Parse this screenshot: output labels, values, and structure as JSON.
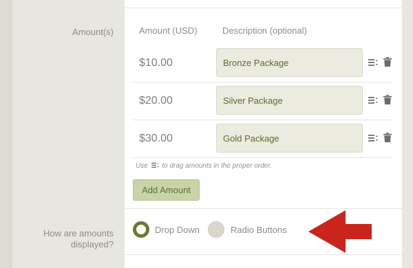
{
  "amounts_section": {
    "label": "Amount(s)",
    "col_amount": "Amount (USD)",
    "col_description": "Description (optional)",
    "rows": [
      {
        "amount": "$10.00",
        "description": "Bronze Package"
      },
      {
        "amount": "$20.00",
        "description": "Silver Package"
      },
      {
        "amount": "$30.00",
        "description": "Gold Package"
      }
    ],
    "hint_before": "Use",
    "hint_after": "to drag amounts in the proper order.",
    "add_button": "Add Amount"
  },
  "display_section": {
    "label_line1": "How are amounts",
    "label_line2": "displayed?",
    "options": [
      {
        "label": "Drop Down",
        "selected": true
      },
      {
        "label": "Radio Buttons",
        "selected": false
      }
    ]
  },
  "icons": {
    "drag": "drag-handle-icon",
    "delete": "trash-icon",
    "annotation": "red-arrow-left"
  },
  "colors": {
    "accent": "#6b7a2c",
    "button_bg": "#c8d4a8",
    "arrow": "#c9251c"
  }
}
